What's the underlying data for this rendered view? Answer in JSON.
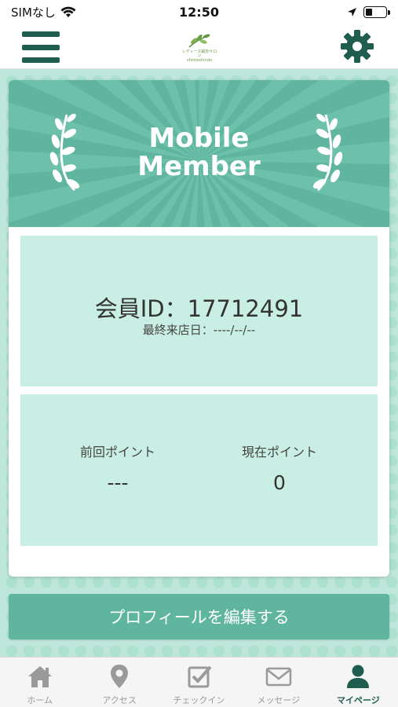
{
  "status_bar": {
    "carrier": "SIMなし",
    "time": "12:50",
    "battery_level": 0.35
  },
  "nav": {
    "logo_text_line1": "レディース鍼灸サロン",
    "logo_text_line2": "shintoshindo"
  },
  "card": {
    "title_line1": "Mobile",
    "title_line2": "Member",
    "member_id": "会員ID：17712491",
    "last_visit": "最終来店日：----/--/--",
    "previous_points_label": "前回ポイント",
    "previous_points_value": "---",
    "current_points_label": "現在ポイント",
    "current_points_value": "0"
  },
  "edit_profile_label": "プロフィールを編集する",
  "tabs": [
    {
      "label": "ホーム",
      "icon": "home-icon"
    },
    {
      "label": "アクセス",
      "icon": "map-pin-icon"
    },
    {
      "label": "チェックイン",
      "icon": "checkbox-icon"
    },
    {
      "label": "メッセージ",
      "icon": "envelope-icon"
    },
    {
      "label": "マイページ",
      "icon": "person-icon",
      "active": true
    }
  ],
  "colors": {
    "primary_dark": "#1f5d4f",
    "accent": "#5fb59d",
    "panel_bg": "#c9eee3",
    "page_bg": "#bfe6da"
  }
}
